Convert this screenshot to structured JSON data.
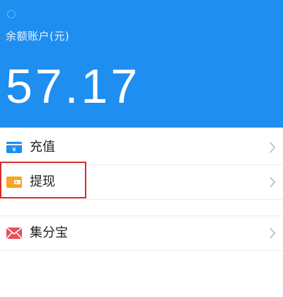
{
  "header": {
    "balance_label": "余额账户(元)",
    "balance_amount": "57.17",
    "background_color": "#1e8ef0"
  },
  "menu": {
    "items": [
      {
        "label": "充值",
        "icon": "yuan-card-icon",
        "icon_color": "#1e8ef0"
      },
      {
        "label": "提现",
        "icon": "wallet-icon",
        "icon_color": "#f5a623"
      },
      {
        "label": "集分宝",
        "icon": "jifenbao-icon",
        "icon_color": "#e8505b"
      }
    ]
  },
  "highlight": {
    "target": "提现",
    "color": "#d4302c"
  }
}
